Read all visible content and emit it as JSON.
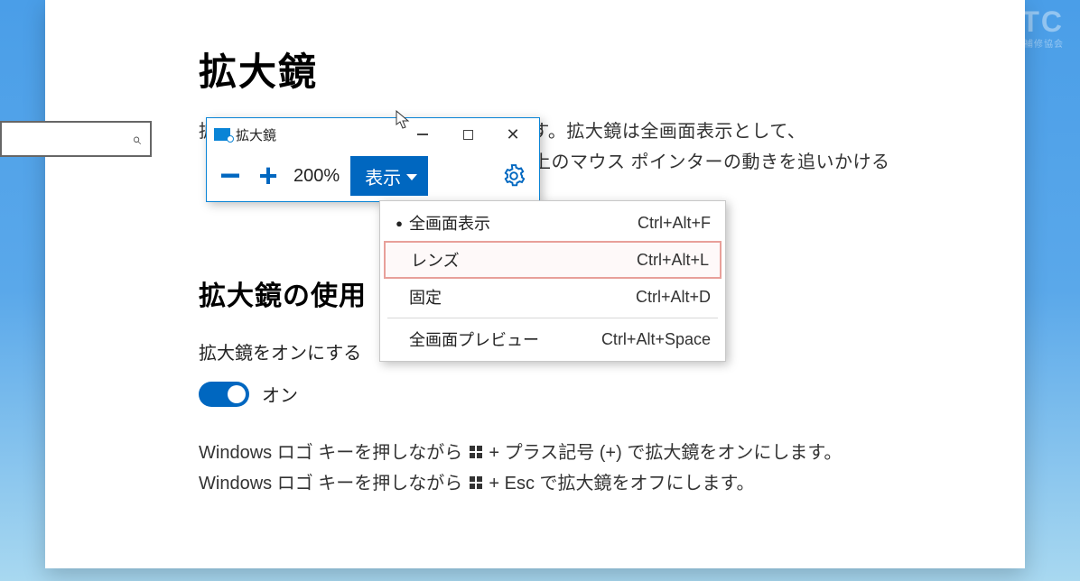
{
  "watermark": {
    "brand": "JEMTC",
    "subtitle": "一般社団法人 日本電子機器補修協会"
  },
  "settings": {
    "page_title": "拡大鏡",
    "desc1": "拡大鏡を使用して画面の一部を拡大します。拡大鏡は全画面表示として、",
    "desc2_right": "上のマウス ポインターの動きを追いかける",
    "section_heading": "拡大鏡の使用",
    "toggle_label": "拡大鏡をオンにする",
    "toggle_state": "オン",
    "info1a": "Windows ロゴ キーを押しながら ",
    "info1b": " + プラス記号 (+) で拡大鏡をオンにします。",
    "info2a": "Windows ロゴ キーを押しながら ",
    "info2b": " + Esc で拡大鏡をオフにします。"
  },
  "magnifier": {
    "title": "拡大鏡",
    "zoom_level": "200%",
    "view_button": "表示"
  },
  "view_menu": {
    "items": [
      {
        "label": "全画面表示",
        "shortcut": "Ctrl+Alt+F",
        "selected": true
      },
      {
        "label": "レンズ",
        "shortcut": "Ctrl+Alt+L",
        "highlight": true
      },
      {
        "label": "固定",
        "shortcut": "Ctrl+Alt+D"
      }
    ],
    "preview": {
      "label": "全画面プレビュー",
      "shortcut": "Ctrl+Alt+Space"
    }
  }
}
